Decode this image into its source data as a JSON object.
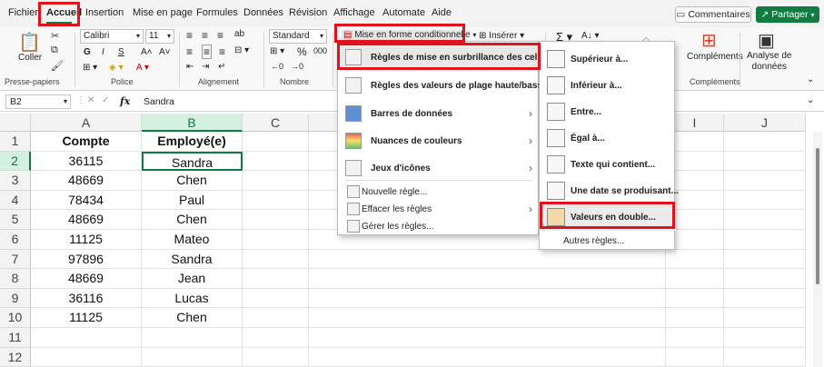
{
  "tabs": [
    "Fichier",
    "Accueil",
    "Insertion",
    "Mise en page",
    "Formules",
    "Données",
    "Révision",
    "Affichage",
    "Automate",
    "Aide"
  ],
  "active_tab": "Accueil",
  "buttons": {
    "comments": "Commentaires",
    "share": "Partager"
  },
  "ribbon": {
    "paste": "Coller",
    "font_name": "Calibri",
    "font_size": "11",
    "number_format": "Standard",
    "cond_format": "Mise en forme conditionnelle",
    "insert": "Insérer",
    "addins": "Compléments",
    "analyze": "Analyse de\ndonnées",
    "groups": [
      "Presse-papiers",
      "Police",
      "Alignement",
      "Nombre",
      "Compléments"
    ]
  },
  "formula_bar": {
    "name_box": "B2",
    "fx": "fx",
    "value": "Sandra"
  },
  "columns": [
    "A",
    "B",
    "C",
    "I",
    "J"
  ],
  "rows": [
    "1",
    "2",
    "3",
    "4",
    "5",
    "6",
    "7",
    "8",
    "9",
    "10",
    "11",
    "12"
  ],
  "table": {
    "headers": [
      "Compte",
      "Employé(e)"
    ],
    "rows": [
      [
        "36115",
        "Sandra"
      ],
      [
        "48669",
        "Chen"
      ],
      [
        "78434",
        "Paul"
      ],
      [
        "48669",
        "Chen"
      ],
      [
        "11125",
        "Mateo"
      ],
      [
        "97896",
        "Sandra"
      ],
      [
        "48669",
        "Jean"
      ],
      [
        "36116",
        "Lucas"
      ],
      [
        "11125",
        "Chen"
      ]
    ]
  },
  "menu": [
    "Règles de mise en surbrillance des cellules",
    "Règles des valeurs de plage haute/basse",
    "Barres de données",
    "Nuances de couleurs",
    "Jeux d'icônes",
    "Nouvelle règle...",
    "Effacer les règles",
    "Gérer les règles..."
  ],
  "submenu": [
    "Supérieur à...",
    "Inférieur à...",
    "Entre...",
    "Égal à...",
    "Texte qui contient...",
    "Une date se produisant...",
    "Valeurs en double...",
    "Autres règles..."
  ],
  "colors": {
    "accent": "#107c41",
    "highlight": "#e0121b"
  }
}
